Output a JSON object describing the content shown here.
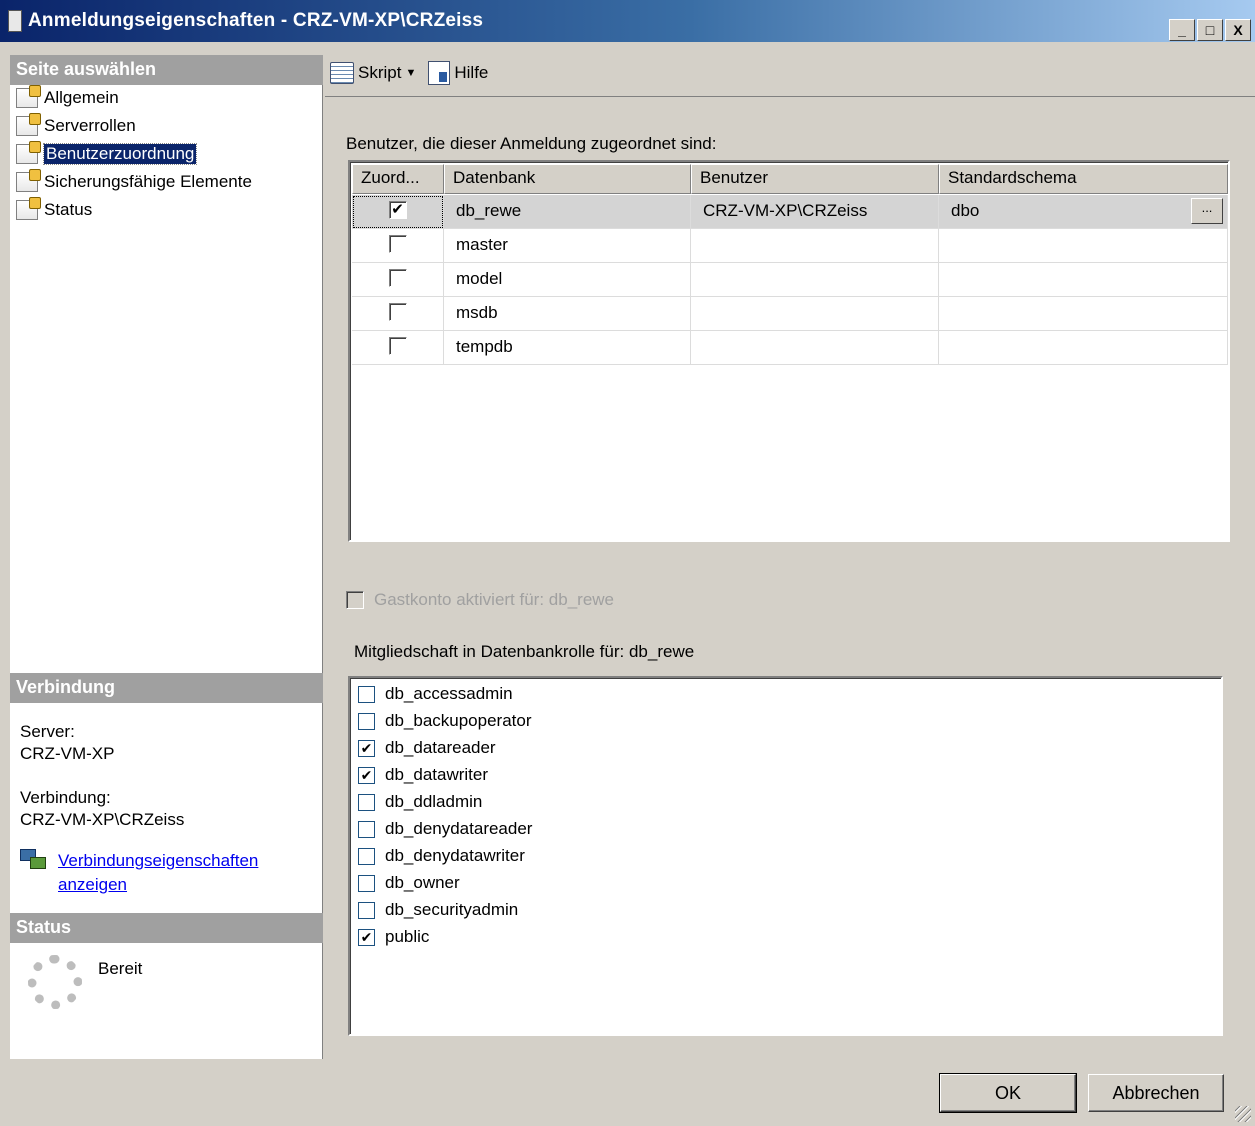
{
  "window": {
    "title": "Anmeldungseigenschaften - CRZ-VM-XP\\CRZeiss",
    "minimize": "_",
    "maximize": "□",
    "close": "X"
  },
  "left": {
    "select_page_header": "Seite auswählen",
    "nav_items": [
      {
        "label": "Allgemein"
      },
      {
        "label": "Serverrollen"
      },
      {
        "label": "Benutzerzuordnung",
        "selected": true
      },
      {
        "label": "Sicherungsfähige Elemente"
      },
      {
        "label": "Status"
      }
    ],
    "connection_header": "Verbindung",
    "server_label": "Server:",
    "server_value": "CRZ-VM-XP",
    "connection_label": "Verbindung:",
    "connection_value": "CRZ-VM-XP\\CRZeiss",
    "link_line1": "Verbindungseigenschaften",
    "link_line2": "anzeigen",
    "status_header": "Status",
    "status_value": "Bereit"
  },
  "toolbar": {
    "script_label": "Skript",
    "help_label": "Hilfe"
  },
  "users": {
    "label": "Benutzer, die dieser Anmeldung zugeordnet sind:",
    "columns": [
      "Zuord...",
      "Datenbank",
      "Benutzer",
      "Standardschema"
    ],
    "rows": [
      {
        "mapped": "✔",
        "database": "db_rewe",
        "user": "CRZ-VM-XP\\CRZeiss",
        "schema": "dbo"
      },
      {
        "mapped": "",
        "database": "master",
        "user": "",
        "schema": ""
      },
      {
        "mapped": "",
        "database": "model",
        "user": "",
        "schema": ""
      },
      {
        "mapped": "",
        "database": "msdb",
        "user": "",
        "schema": ""
      },
      {
        "mapped": "",
        "database": "tempdb",
        "user": "",
        "schema": ""
      }
    ],
    "ellipsis": "..."
  },
  "guest": {
    "label": "Gastkonto aktiviert für: db_rewe"
  },
  "roles": {
    "label": "Mitgliedschaft in Datenbankrolle für: db_rewe",
    "items": [
      {
        "name": "db_accessadmin",
        "checked": ""
      },
      {
        "name": "db_backupoperator",
        "checked": ""
      },
      {
        "name": "db_datareader",
        "checked": "✔"
      },
      {
        "name": "db_datawriter",
        "checked": "✔"
      },
      {
        "name": "db_ddladmin",
        "checked": ""
      },
      {
        "name": "db_denydatareader",
        "checked": ""
      },
      {
        "name": "db_denydatawriter",
        "checked": ""
      },
      {
        "name": "db_owner",
        "checked": ""
      },
      {
        "name": "db_securityadmin",
        "checked": ""
      },
      {
        "name": "public",
        "checked": "✔"
      }
    ]
  },
  "buttons": {
    "ok": "OK",
    "cancel": "Abbrechen"
  },
  "colors": {
    "title_start": "#0a246a",
    "selection": "#0a246a",
    "section_header": "#a0a0a0",
    "link": "#0000ee"
  }
}
